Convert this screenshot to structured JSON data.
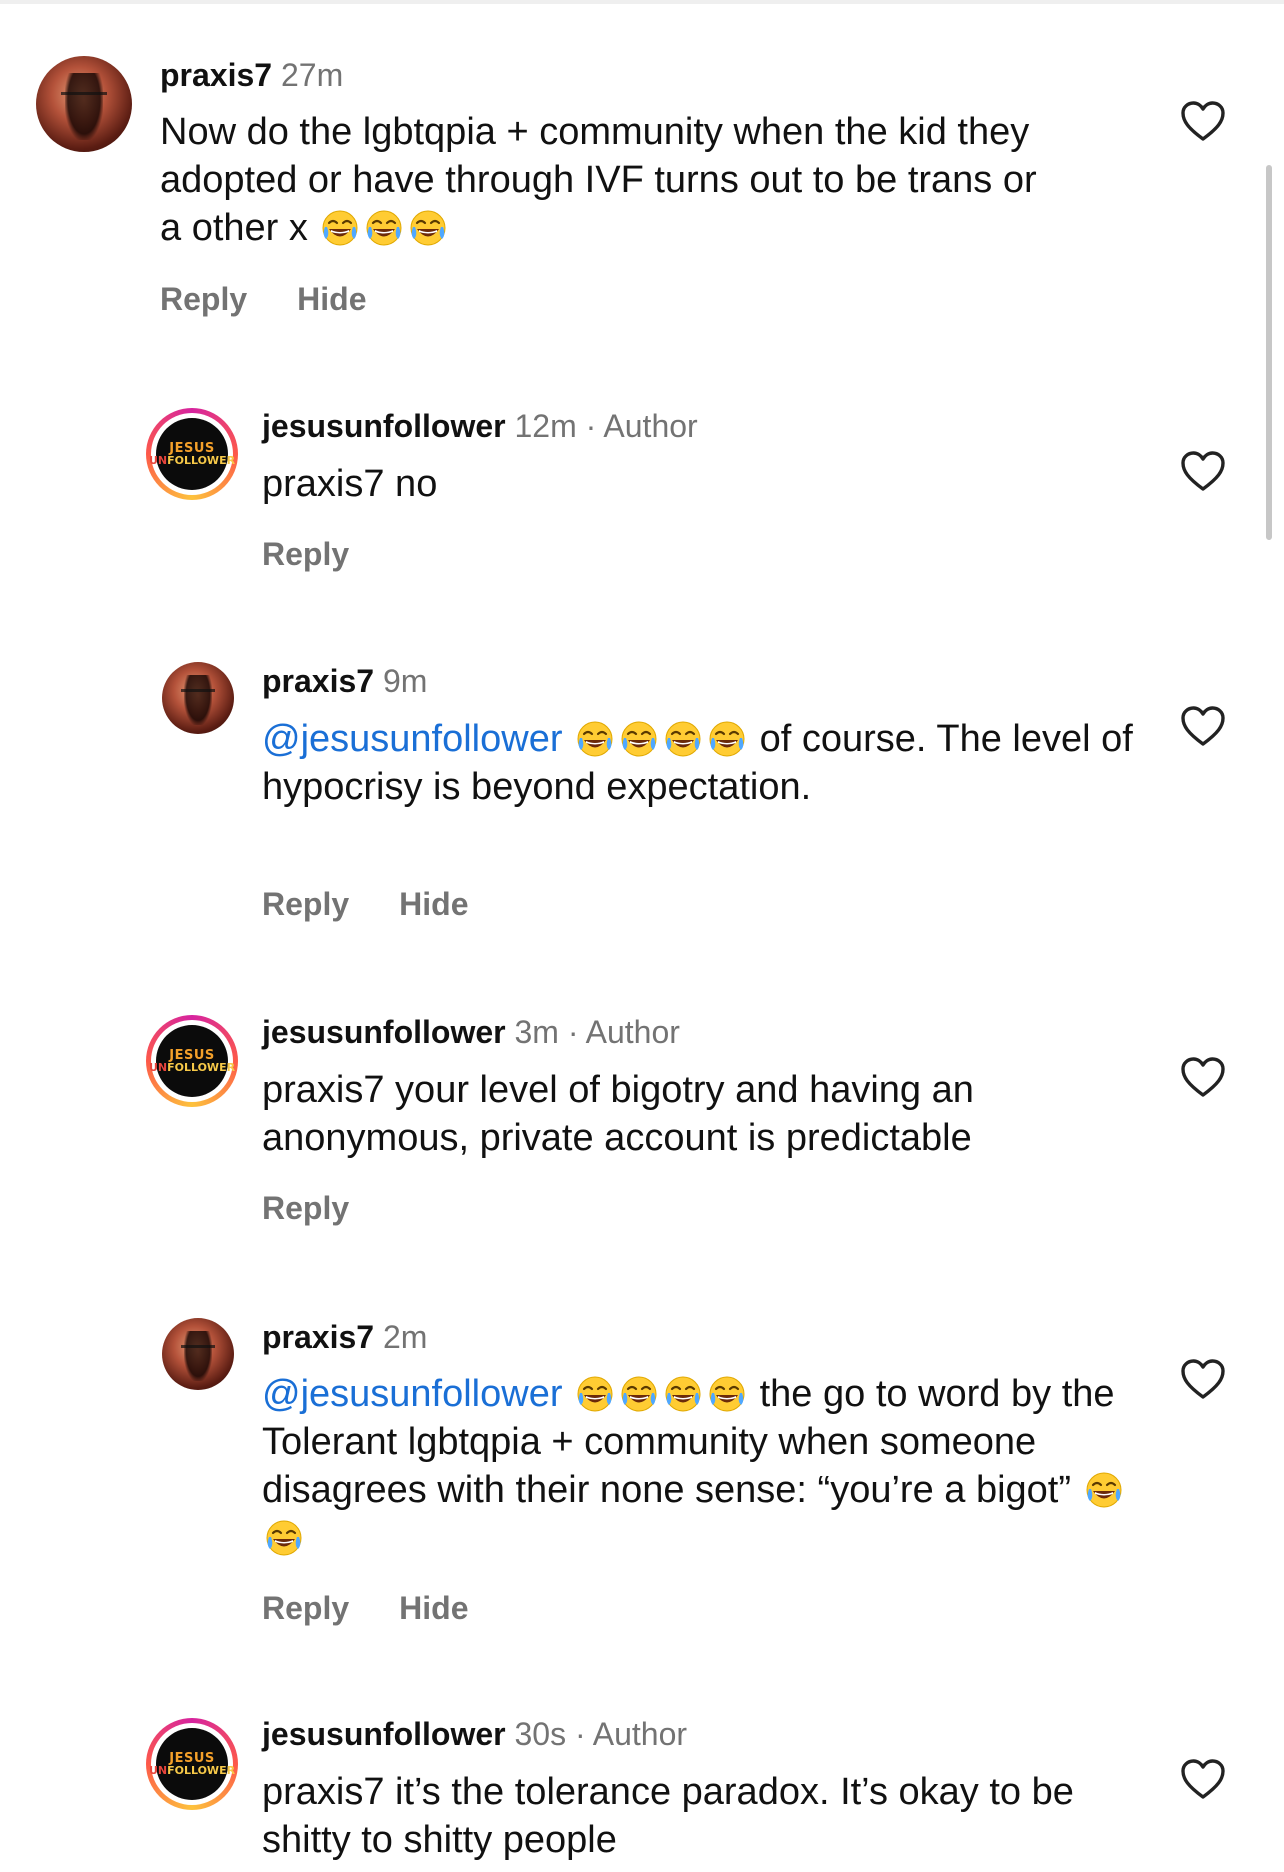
{
  "comments": [
    {
      "user": "praxis7",
      "time": "27m",
      "is_author": false,
      "parts": [
        {
          "t": "text",
          "v": "Now do the lgbtqpia + community when the kid they adopted or have through IVF turns out to be trans or a other x "
        },
        {
          "t": "emoji",
          "n": 3
        }
      ],
      "actions": [
        "Reply",
        "Hide"
      ]
    },
    {
      "user": "jesusunfollower",
      "time": "12m",
      "is_author": true,
      "parts": [
        {
          "t": "text",
          "v": "praxis7 no"
        }
      ],
      "actions": [
        "Reply"
      ]
    },
    {
      "user": "praxis7",
      "time": "9m",
      "is_author": false,
      "parts": [
        {
          "t": "mention",
          "v": "@jesusunfollower"
        },
        {
          "t": "text",
          "v": " "
        },
        {
          "t": "emoji",
          "n": 4
        },
        {
          "t": "text",
          "v": " of course. The level of hypocrisy is beyond expectation."
        }
      ],
      "actions": [
        "Reply",
        "Hide"
      ]
    },
    {
      "user": "jesusunfollower",
      "time": "3m",
      "is_author": true,
      "parts": [
        {
          "t": "text",
          "v": "praxis7 your level of bigotry and having an anonymous, private account is predictable"
        }
      ],
      "actions": [
        "Reply"
      ]
    },
    {
      "user": "praxis7",
      "time": "2m",
      "is_author": false,
      "parts": [
        {
          "t": "mention",
          "v": "@jesusunfollower"
        },
        {
          "t": "text",
          "v": " "
        },
        {
          "t": "emoji",
          "n": 4
        },
        {
          "t": "text",
          "v": " the go to word by the Tolerant lgbtqpia + community when someone disagrees with their none sense: “you’re a bigot” "
        },
        {
          "t": "emoji",
          "n": 2
        }
      ],
      "actions": [
        "Reply",
        "Hide"
      ]
    },
    {
      "user": "jesusunfollower",
      "time": "30s",
      "is_author": true,
      "parts": [
        {
          "t": "text",
          "v": "praxis7 it’s the tolerance paradox. It’s okay to be shitty to shitty people"
        }
      ],
      "actions": [
        "Reply"
      ]
    }
  ],
  "labels": {
    "author": "Author",
    "separator": " · "
  },
  "logo": {
    "line1": "JESUS",
    "line2a": "UN",
    "line2b": "FOLLOWER"
  },
  "icons": {
    "emoji": "face-with-tears-of-joy-icon",
    "like": "heart-outline-icon"
  },
  "colors": {
    "mention": "#1a6fd6",
    "secondary_text": "#737373"
  }
}
